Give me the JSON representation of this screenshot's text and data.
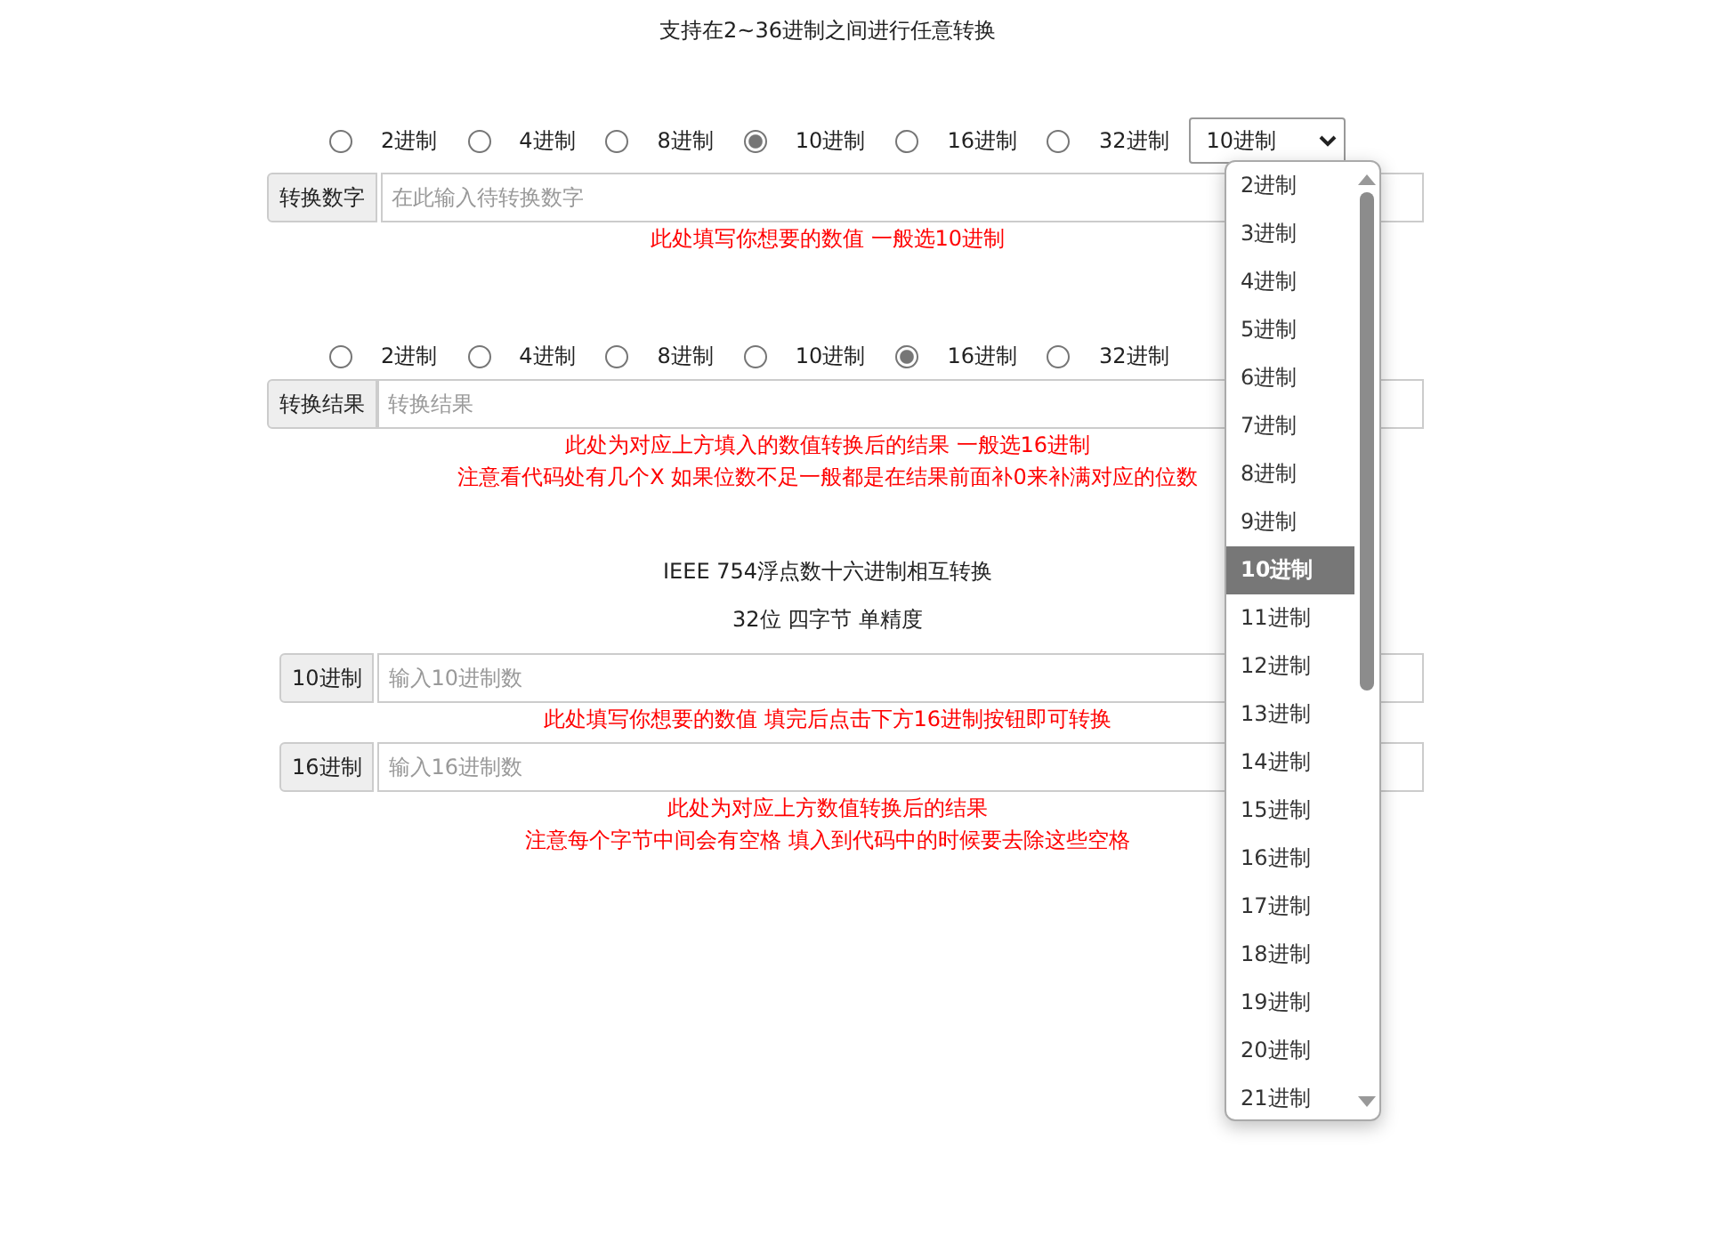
{
  "title": "支持在2~36进制之间进行任意转换",
  "input_radix": {
    "options": [
      {
        "label": "2进制",
        "selected": false
      },
      {
        "label": "4进制",
        "selected": false
      },
      {
        "label": "8进制",
        "selected": false
      },
      {
        "label": "10进制",
        "selected": true
      },
      {
        "label": "16进制",
        "selected": false
      },
      {
        "label": "32进制",
        "selected": false
      }
    ],
    "select_value": "10进制"
  },
  "input_group": {
    "label": "转换数字",
    "placeholder": "在此输入待转换数字",
    "hints": [
      "此处填写你想要的数值 一般选10进制"
    ]
  },
  "output_radix": {
    "options": [
      {
        "label": "2进制",
        "selected": false
      },
      {
        "label": "4进制",
        "selected": false
      },
      {
        "label": "8进制",
        "selected": false
      },
      {
        "label": "10进制",
        "selected": false
      },
      {
        "label": "16进制",
        "selected": true
      },
      {
        "label": "32进制",
        "selected": false
      }
    ]
  },
  "output_group": {
    "label": "转换结果",
    "placeholder": "转换结果",
    "hints": [
      "此处为对应上方填入的数值转换后的结果 一般选16进制",
      "注意看代码处有几个X 如果位数不足一般都是在结果前面补0来补满对应的位数"
    ]
  },
  "ieee_title": "IEEE 754浮点数十六进制相互转换",
  "ieee_subtitle": "32位 四字节 单精度",
  "ieee_groups": [
    {
      "label": "10进制",
      "placeholder": "输入10进制数",
      "hints": [
        "此处填写你想要的数值 填完后点击下方16进制按钮即可转换"
      ]
    },
    {
      "label": "16进制",
      "placeholder": "输入16进制数",
      "hints": [
        "此处为对应上方数值转换后的结果",
        "注意每个字节中间会有空格 填入到代码中的时候要去除这些空格"
      ]
    }
  ],
  "dropdown": {
    "options": [
      {
        "label": "2进制",
        "selected": false
      },
      {
        "label": "3进制",
        "selected": false
      },
      {
        "label": "4进制",
        "selected": false
      },
      {
        "label": "5进制",
        "selected": false
      },
      {
        "label": "6进制",
        "selected": false
      },
      {
        "label": "7进制",
        "selected": false
      },
      {
        "label": "8进制",
        "selected": false
      },
      {
        "label": "9进制",
        "selected": false
      },
      {
        "label": "10进制",
        "selected": true
      },
      {
        "label": "11进制",
        "selected": false
      },
      {
        "label": "12进制",
        "selected": false
      },
      {
        "label": "13进制",
        "selected": false
      },
      {
        "label": "14进制",
        "selected": false
      },
      {
        "label": "15进制",
        "selected": false
      },
      {
        "label": "16进制",
        "selected": false
      },
      {
        "label": "17进制",
        "selected": false
      },
      {
        "label": "18进制",
        "selected": false
      },
      {
        "label": "19进制",
        "selected": false
      },
      {
        "label": "20进制",
        "selected": false
      },
      {
        "label": "21进制",
        "selected": false
      }
    ]
  }
}
